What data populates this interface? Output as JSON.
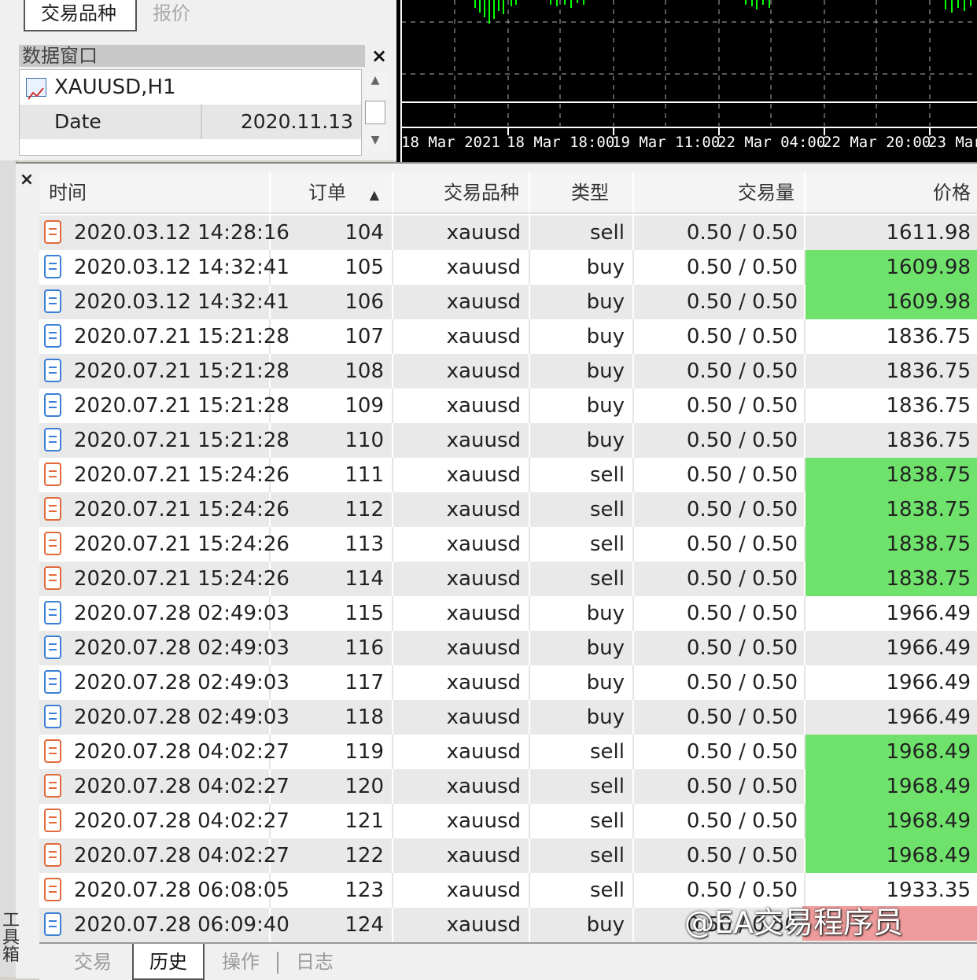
{
  "market_watch": {
    "tabs": [
      "交易品种",
      "报价"
    ]
  },
  "data_window": {
    "title": "数据窗口",
    "close": "×",
    "symbol": "XAUUSD,H1",
    "date_label": "Date",
    "date_value": "2020.11.13"
  },
  "chart": {
    "x_labels": [
      "18 Mar 2021",
      "18 Mar 18:00",
      "19 Mar 11:00",
      "22 Mar 04:00",
      "22 Mar 20:00",
      "23 Mar"
    ]
  },
  "terminal": {
    "close": "×",
    "side_label": "工具箱",
    "columns": [
      "时间",
      "订单",
      "交易品种",
      "类型",
      "交易量",
      "价格"
    ],
    "sort_indicator": "▲",
    "rows": [
      {
        "time": "2020.03.12 14:28:16",
        "order": "104",
        "symbol": "xauusd",
        "type": "sell",
        "volume": "0.50 / 0.50",
        "price": "1611.98",
        "highlight": false
      },
      {
        "time": "2020.03.12 14:32:41",
        "order": "105",
        "symbol": "xauusd",
        "type": "buy",
        "volume": "0.50 / 0.50",
        "price": "1609.98",
        "highlight": true
      },
      {
        "time": "2020.03.12 14:32:41",
        "order": "106",
        "symbol": "xauusd",
        "type": "buy",
        "volume": "0.50 / 0.50",
        "price": "1609.98",
        "highlight": true
      },
      {
        "time": "2020.07.21 15:21:28",
        "order": "107",
        "symbol": "xauusd",
        "type": "buy",
        "volume": "0.50 / 0.50",
        "price": "1836.75",
        "highlight": false
      },
      {
        "time": "2020.07.21 15:21:28",
        "order": "108",
        "symbol": "xauusd",
        "type": "buy",
        "volume": "0.50 / 0.50",
        "price": "1836.75",
        "highlight": false
      },
      {
        "time": "2020.07.21 15:21:28",
        "order": "109",
        "symbol": "xauusd",
        "type": "buy",
        "volume": "0.50 / 0.50",
        "price": "1836.75",
        "highlight": false
      },
      {
        "time": "2020.07.21 15:21:28",
        "order": "110",
        "symbol": "xauusd",
        "type": "buy",
        "volume": "0.50 / 0.50",
        "price": "1836.75",
        "highlight": false
      },
      {
        "time": "2020.07.21 15:24:26",
        "order": "111",
        "symbol": "xauusd",
        "type": "sell",
        "volume": "0.50 / 0.50",
        "price": "1838.75",
        "highlight": true
      },
      {
        "time": "2020.07.21 15:24:26",
        "order": "112",
        "symbol": "xauusd",
        "type": "sell",
        "volume": "0.50 / 0.50",
        "price": "1838.75",
        "highlight": true
      },
      {
        "time": "2020.07.21 15:24:26",
        "order": "113",
        "symbol": "xauusd",
        "type": "sell",
        "volume": "0.50 / 0.50",
        "price": "1838.75",
        "highlight": true
      },
      {
        "time": "2020.07.21 15:24:26",
        "order": "114",
        "symbol": "xauusd",
        "type": "sell",
        "volume": "0.50 / 0.50",
        "price": "1838.75",
        "highlight": true
      },
      {
        "time": "2020.07.28 02:49:03",
        "order": "115",
        "symbol": "xauusd",
        "type": "buy",
        "volume": "0.50 / 0.50",
        "price": "1966.49",
        "highlight": false
      },
      {
        "time": "2020.07.28 02:49:03",
        "order": "116",
        "symbol": "xauusd",
        "type": "buy",
        "volume": "0.50 / 0.50",
        "price": "1966.49",
        "highlight": false
      },
      {
        "time": "2020.07.28 02:49:03",
        "order": "117",
        "symbol": "xauusd",
        "type": "buy",
        "volume": "0.50 / 0.50",
        "price": "1966.49",
        "highlight": false
      },
      {
        "time": "2020.07.28 02:49:03",
        "order": "118",
        "symbol": "xauusd",
        "type": "buy",
        "volume": "0.50 / 0.50",
        "price": "1966.49",
        "highlight": false
      },
      {
        "time": "2020.07.28 04:02:27",
        "order": "119",
        "symbol": "xauusd",
        "type": "sell",
        "volume": "0.50 / 0.50",
        "price": "1968.49",
        "highlight": true
      },
      {
        "time": "2020.07.28 04:02:27",
        "order": "120",
        "symbol": "xauusd",
        "type": "sell",
        "volume": "0.50 / 0.50",
        "price": "1968.49",
        "highlight": true
      },
      {
        "time": "2020.07.28 04:02:27",
        "order": "121",
        "symbol": "xauusd",
        "type": "sell",
        "volume": "0.50 / 0.50",
        "price": "1968.49",
        "highlight": true
      },
      {
        "time": "2020.07.28 04:02:27",
        "order": "122",
        "symbol": "xauusd",
        "type": "sell",
        "volume": "0.50 / 0.50",
        "price": "1968.49",
        "highlight": true
      },
      {
        "time": "2020.07.28 06:08:05",
        "order": "123",
        "symbol": "xauusd",
        "type": "sell",
        "volume": "0.50 / 0.50",
        "price": "1933.35",
        "highlight": false
      },
      {
        "time": "2020.07.28 06:09:40",
        "order": "124",
        "symbol": "xauusd",
        "type": "buy",
        "volume": "0.50 / 0.50",
        "price": "",
        "highlight": false
      }
    ],
    "bottom_tabs": [
      "交易",
      "历史",
      "操作",
      "日志"
    ],
    "active_tab": "历史"
  },
  "watermark": "@EA交易程序员",
  "colors": {
    "highlight": "#6fe26b",
    "sell_icon": "#e06a3a",
    "buy_icon": "#3b7fd6",
    "chart_bg": "#000000",
    "chart_candle": "#00ff00"
  }
}
